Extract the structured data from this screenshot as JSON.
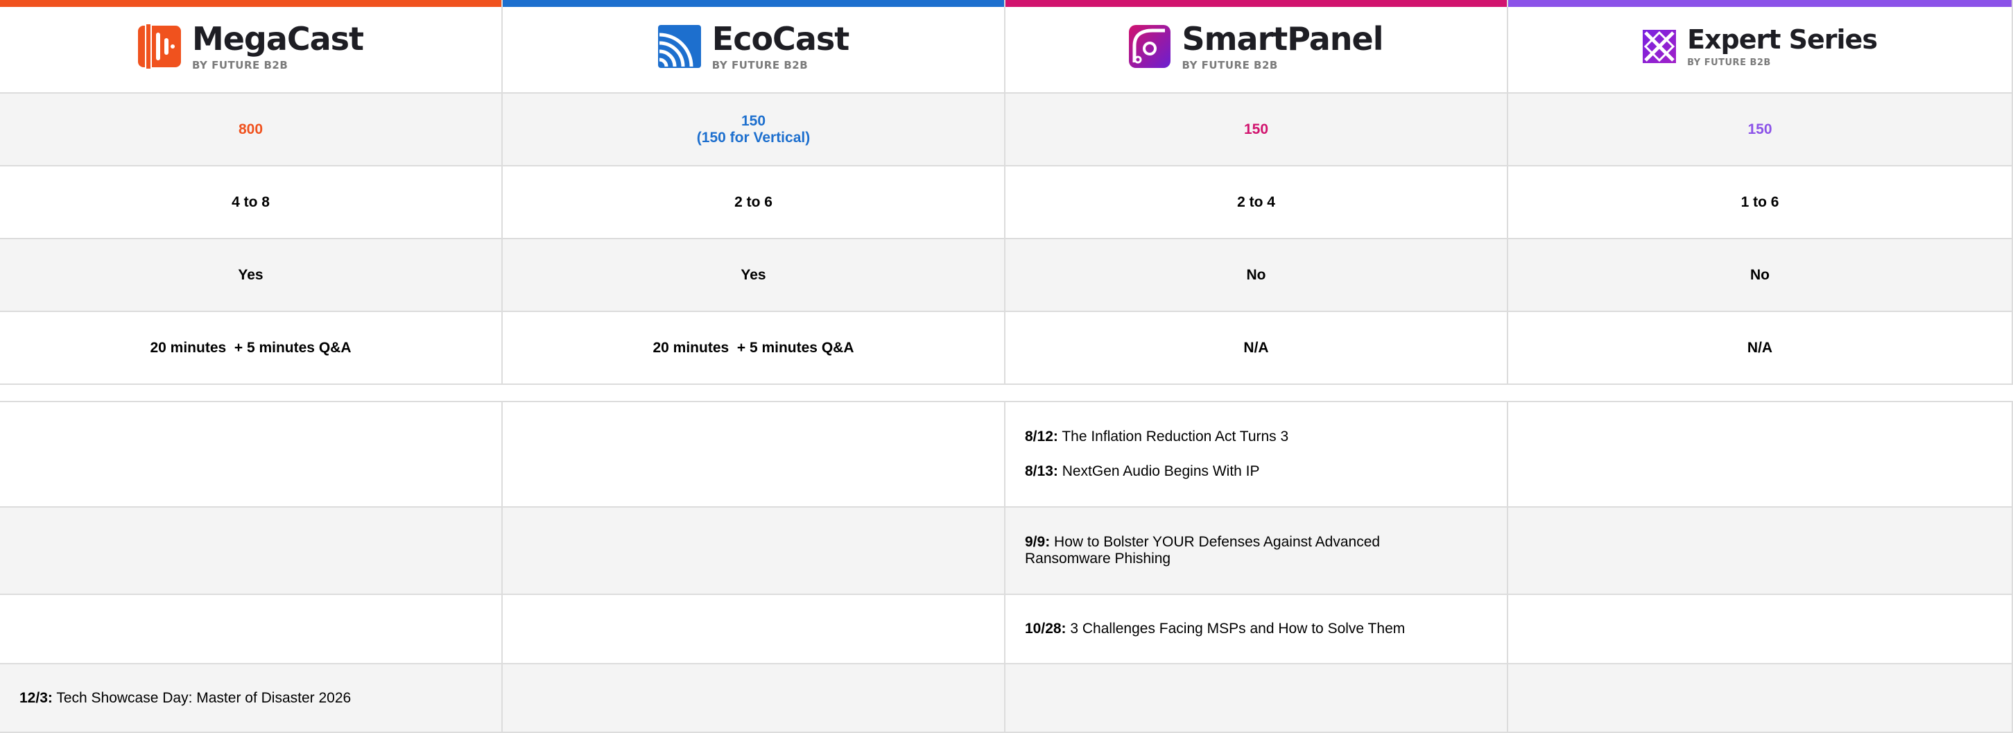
{
  "colors": {
    "megacast": "#f0521e",
    "ecocast": "#1d6fce",
    "smartpanel": "#d1136e",
    "expert": "#8b52e8"
  },
  "brands": [
    {
      "name": "MegaCast",
      "sub": "BY FUTURE B2B",
      "icon": "megacast-logo-icon"
    },
    {
      "name": "EcoCast",
      "sub": "BY FUTURE B2B",
      "icon": "ecocast-logo-icon"
    },
    {
      "name": "SmartPanel",
      "sub": "BY FUTURE B2B",
      "icon": "smartpanel-logo-icon"
    },
    {
      "name": "Expert Series",
      "sub": "BY FUTURE B2B",
      "icon": "expert-series-logo-icon"
    }
  ],
  "summary": {
    "rows": [
      [
        "800",
        "150\n(150 for Vertical)",
        "150",
        "150"
      ],
      [
        "4 to 8",
        "2 to 6",
        "2 to 4",
        "1 to 6"
      ],
      [
        "Yes",
        "Yes",
        "No",
        "No"
      ],
      [
        "20 minutes  + 5 minutes Q&A",
        "20 minutes  + 5 minutes Q&A",
        "N/A",
        "N/A"
      ]
    ],
    "row2_line1": "150",
    "row2_line2": "(150 for Vertical)"
  },
  "events": {
    "e1_date": "8/12:",
    "e1_title": " The Inflation Reduction Act Turns 3",
    "e2_date": "8/13:",
    "e2_title": " NextGen Audio Begins With IP",
    "e3_date": "9/9:",
    "e3_title": " How to Bolster YOUR Defenses Against Advanced Ransomware Phishing",
    "e4_date": "10/28:",
    "e4_title": " 3 Challenges Facing MSPs and How to Solve Them",
    "e5_date": "12/3:",
    "e5_title": " Tech Showcase Day: Master of Disaster 2026"
  }
}
